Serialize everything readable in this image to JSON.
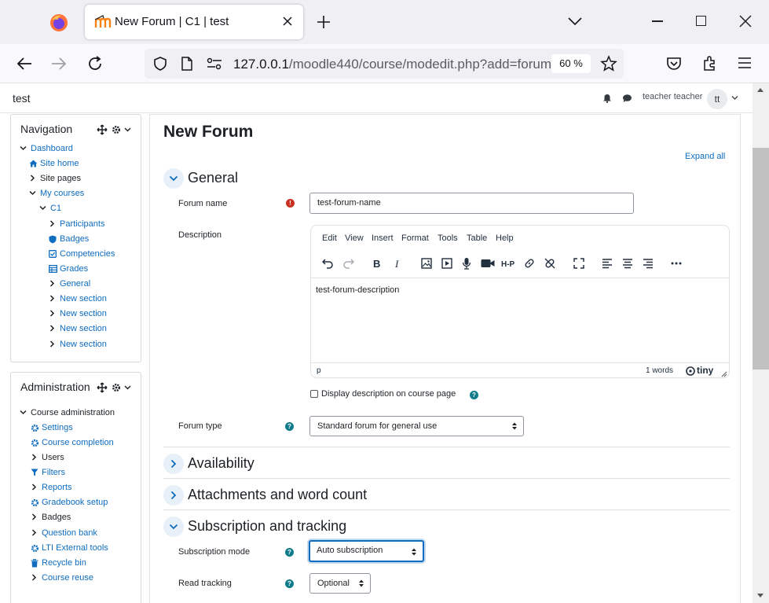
{
  "browser": {
    "tab_title": "New Forum | C1 | test",
    "url_host": "127.0.0.1",
    "url_path": "/moodle440/course/modedit.php?add=forum",
    "zoom": "60 %"
  },
  "header": {
    "site_name": "test",
    "user_name": "teacher teacher",
    "avatar_initials": "tt"
  },
  "navigation": {
    "title": "Navigation",
    "items": [
      {
        "label": "Dashboard",
        "icon": "chevron-down-icon"
      },
      {
        "label": "Site home",
        "icon": "home-icon"
      },
      {
        "label": "Site pages",
        "icon": "chevron-right-icon"
      },
      {
        "label": "My courses",
        "icon": "chevron-down-icon"
      },
      {
        "label": "C1",
        "icon": "chevron-down-icon"
      },
      {
        "label": "Participants",
        "icon": "chevron-right-icon"
      },
      {
        "label": "Badges",
        "icon": "shield-icon"
      },
      {
        "label": "Competencies",
        "icon": "checkbox-icon"
      },
      {
        "label": "Grades",
        "icon": "table-icon"
      },
      {
        "label": "General",
        "icon": "chevron-right-icon"
      },
      {
        "label": "New section",
        "icon": "chevron-right-icon"
      },
      {
        "label": "New section",
        "icon": "chevron-right-icon"
      },
      {
        "label": "New section",
        "icon": "chevron-right-icon"
      },
      {
        "label": "New section",
        "icon": "chevron-right-icon"
      }
    ]
  },
  "administration": {
    "title": "Administration",
    "items": [
      {
        "label": "Course administration",
        "icon": "chevron-down-icon"
      },
      {
        "label": "Settings",
        "icon": "gear-icon"
      },
      {
        "label": "Course completion",
        "icon": "gear-icon"
      },
      {
        "label": "Users",
        "icon": "chevron-right-icon"
      },
      {
        "label": "Filters",
        "icon": "filter-icon"
      },
      {
        "label": "Reports",
        "icon": "chevron-right-icon"
      },
      {
        "label": "Gradebook setup",
        "icon": "gear-icon"
      },
      {
        "label": "Badges",
        "icon": "chevron-right-icon"
      },
      {
        "label": "Question bank",
        "icon": "chevron-right-icon"
      },
      {
        "label": "LTI External tools",
        "icon": "gear-icon"
      },
      {
        "label": "Recycle bin",
        "icon": "trash-icon"
      },
      {
        "label": "Course reuse",
        "icon": "chevron-right-icon"
      }
    ]
  },
  "main": {
    "page_title": "New Forum",
    "expand_all": "Expand all",
    "sections": {
      "general": "General",
      "availability": "Availability",
      "attachments": "Attachments and word count",
      "subscription": "Subscription and tracking"
    },
    "fields": {
      "forum_name_label": "Forum name",
      "forum_name_value": "test-forum-name",
      "description_label": "Description",
      "description_value": "test-forum-description",
      "display_description_label": "Display description on course page",
      "forum_type_label": "Forum type",
      "forum_type_value": "Standard forum for general use",
      "subscription_mode_label": "Subscription mode",
      "subscription_mode_value": "Auto subscription",
      "read_tracking_label": "Read tracking",
      "read_tracking_value": "Optional"
    },
    "editor": {
      "menus": [
        "Edit",
        "View",
        "Insert",
        "Format",
        "Tools",
        "Table",
        "Help"
      ],
      "status_path": "p",
      "word_count": "1 words",
      "brand": "tiny"
    }
  },
  "colors": {
    "link": "#0f6cbf",
    "required": "#ca3120",
    "help": "#0f7b8a",
    "section_circle": "#e7f0f8"
  }
}
